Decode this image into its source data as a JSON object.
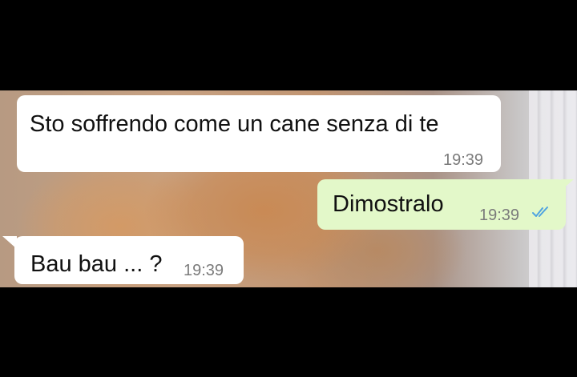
{
  "messages": [
    {
      "direction": "incoming",
      "text": "Sto soffrendo come un cane senza di te",
      "time": "19:39"
    },
    {
      "direction": "outgoing",
      "text": "Dimostralo",
      "time": "19:39",
      "status_icon": "double-check-icon",
      "status_color": "#4fa3e0"
    },
    {
      "direction": "incoming",
      "text": "Bau bau ... ?",
      "time": "19:39"
    }
  ],
  "colors": {
    "incoming_bubble": "#ffffff",
    "outgoing_bubble": "#e3f8c9",
    "timestamp": "#7b7b7b",
    "background": "#000000"
  }
}
